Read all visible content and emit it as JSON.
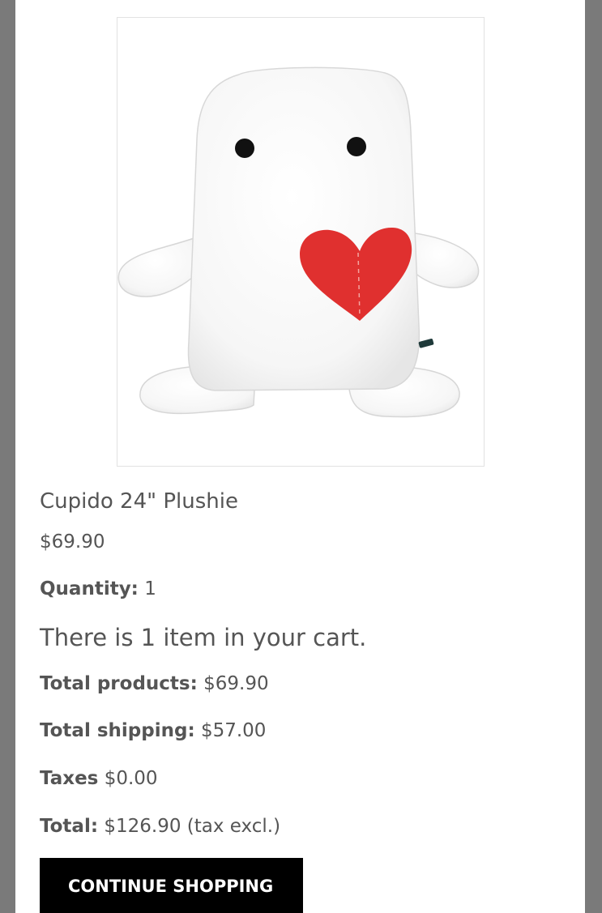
{
  "product": {
    "image_alt": "white plush toy with red heart",
    "name": "Cupido 24\" Plushie",
    "price": "$69.90",
    "quantity_label": "Quantity:",
    "quantity_value": "1"
  },
  "cart": {
    "count_text": "There is 1 item in your cart.",
    "total_products_label": "Total products:",
    "total_products_value": "$69.90",
    "total_shipping_label": "Total shipping:",
    "total_shipping_value": "$57.00",
    "taxes_label": "Taxes",
    "taxes_value": "$0.00",
    "total_label": "Total:",
    "total_value": "$126.90 (tax excl.)"
  },
  "actions": {
    "continue_label": "CONTINUE SHOPPING"
  },
  "colors": {
    "overlay": "#7a7a7a",
    "button_bg": "#000000",
    "button_text": "#ffffff",
    "text": "#555555",
    "heart": "#e0302f"
  }
}
